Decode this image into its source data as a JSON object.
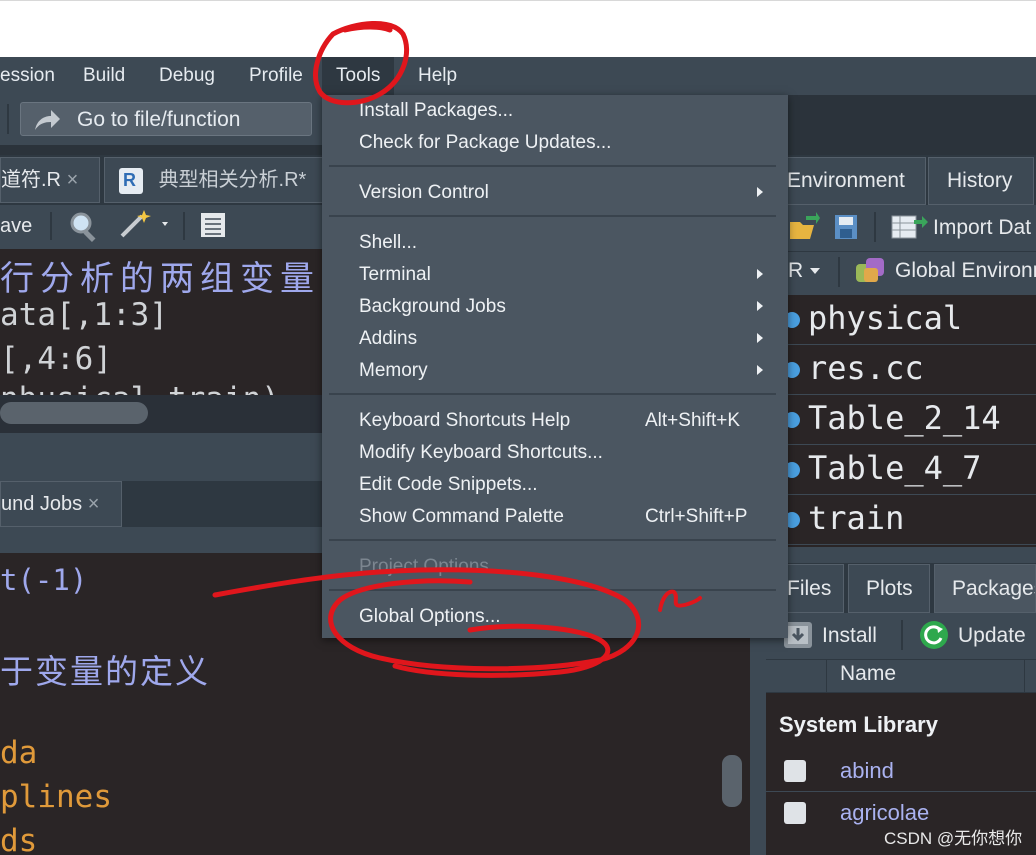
{
  "menubar": {
    "items": [
      "ession",
      "Build",
      "Debug",
      "Profile",
      "Tools",
      "Help"
    ]
  },
  "toolbar": {
    "goto_label": "Go to file/function"
  },
  "editor_tabs": [
    "道符.R",
    "典型相关分析.R*"
  ],
  "editor_toolbar": {
    "save_label": "ave"
  },
  "editor_code": [
    "行分析的两组变量",
    "ata[,1:3]",
    "[,4:6]",
    "nhusical train)"
  ],
  "jobs_tab": "und Jobs",
  "console_code": [
    "t(-1)",
    "",
    "于变量的定义",
    "",
    "da",
    "plines",
    "ds"
  ],
  "env_tabs": [
    "Environment",
    "History"
  ],
  "env_toolbar": {
    "import_label": "Import Dat",
    "r_label": "R",
    "env_label": "Global Environn"
  },
  "env_items": [
    "physical",
    "res.cc",
    "Table_2_14",
    "Table_4_7",
    "train"
  ],
  "bottom_tabs": [
    "Files",
    "Plots",
    "Packages"
  ],
  "packages_toolbar": {
    "install_label": "Install",
    "update_label": "Update"
  },
  "packages_table": {
    "header": "Name",
    "section": "System Library",
    "rows": [
      "abind",
      "agricolae"
    ]
  },
  "tools_menu": {
    "items": [
      {
        "label": "Install Packages...",
        "shortcut": "",
        "submenu": false,
        "disabled": false
      },
      {
        "label": "Check for Package Updates...",
        "shortcut": "",
        "submenu": false,
        "disabled": false
      },
      {
        "label": "Version Control",
        "shortcut": "",
        "submenu": true,
        "disabled": false
      },
      {
        "label": "Shell...",
        "shortcut": "",
        "submenu": false,
        "disabled": false
      },
      {
        "label": "Terminal",
        "shortcut": "",
        "submenu": true,
        "disabled": false
      },
      {
        "label": "Background Jobs",
        "shortcut": "",
        "submenu": true,
        "disabled": false
      },
      {
        "label": "Addins",
        "shortcut": "",
        "submenu": true,
        "disabled": false
      },
      {
        "label": "Memory",
        "shortcut": "",
        "submenu": true,
        "disabled": false
      },
      {
        "label": "Keyboard Shortcuts Help",
        "shortcut": "Alt+Shift+K",
        "submenu": false,
        "disabled": false
      },
      {
        "label": "Modify Keyboard Shortcuts...",
        "shortcut": "",
        "submenu": false,
        "disabled": false
      },
      {
        "label": "Edit Code Snippets...",
        "shortcut": "",
        "submenu": false,
        "disabled": false
      },
      {
        "label": "Show Command Palette",
        "shortcut": "Ctrl+Shift+P",
        "submenu": false,
        "disabled": false
      },
      {
        "label": "Project Options",
        "shortcut": "",
        "submenu": false,
        "disabled": true
      },
      {
        "label": "Global Options...",
        "shortcut": "",
        "submenu": false,
        "disabled": false
      }
    ]
  },
  "watermark": "CSDN @无你想你",
  "colors": {
    "annotation": "#e0161c",
    "menu_bg": "#4b5661",
    "accent_blue": "#4a9fe0"
  }
}
